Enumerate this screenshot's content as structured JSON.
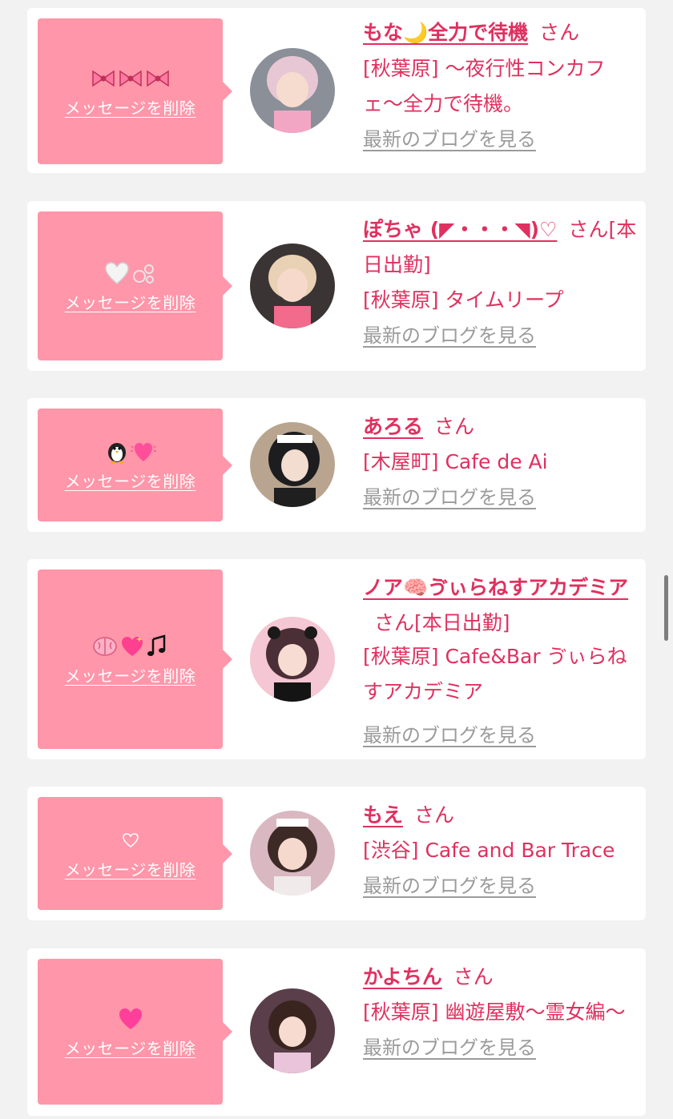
{
  "common": {
    "delete_label": "メッセージを削除",
    "blog_label": "最新のブログを見る",
    "honorific": "さん"
  },
  "colors": {
    "accent": "#e0305f",
    "bubble": "#ff96a9",
    "card_bg": "#ffffff",
    "page_bg": "#f2f2f2",
    "muted": "#9b9b9b"
  },
  "cards": [
    {
      "emojis": [
        "ribbon-icon",
        "ribbon-icon",
        "ribbon-icon"
      ],
      "name": "もな🌙全力で待機",
      "extra": "",
      "shop": "[秋葉原] 〜夜行性コンカフェ〜全力で待機。"
    },
    {
      "emojis": [
        "white-heart-icon",
        "bubbles-icon"
      ],
      "name": "ぽちゃ (◤・・・◥)♡",
      "extra": "[本日出勤]",
      "shop": "[秋葉原] タイムリープ"
    },
    {
      "emojis": [
        "penguin-icon",
        "beating-heart-icon"
      ],
      "name": "あろる",
      "extra": "",
      "shop": "[木屋町] Cafe de Ai"
    },
    {
      "emojis": [
        "brain-icon",
        "sparkling-heart-icon",
        "music-notes-icon"
      ],
      "name": "ノア🧠ゔぃらねすアカデミア",
      "extra": "[本日出勤]",
      "shop": "[秋葉原] Cafe&Bar ゔぃらねすアカデミア"
    },
    {
      "emojis": [
        "outline-heart-icon"
      ],
      "name": "もえ",
      "extra": "",
      "shop": "[渋谷] Cafe and Bar Trace"
    },
    {
      "emojis": [
        "pink-heart-icon"
      ],
      "name": "かよちん",
      "extra": "",
      "shop": "[秋葉原] 幽遊屋敷〜霊女編〜"
    }
  ]
}
